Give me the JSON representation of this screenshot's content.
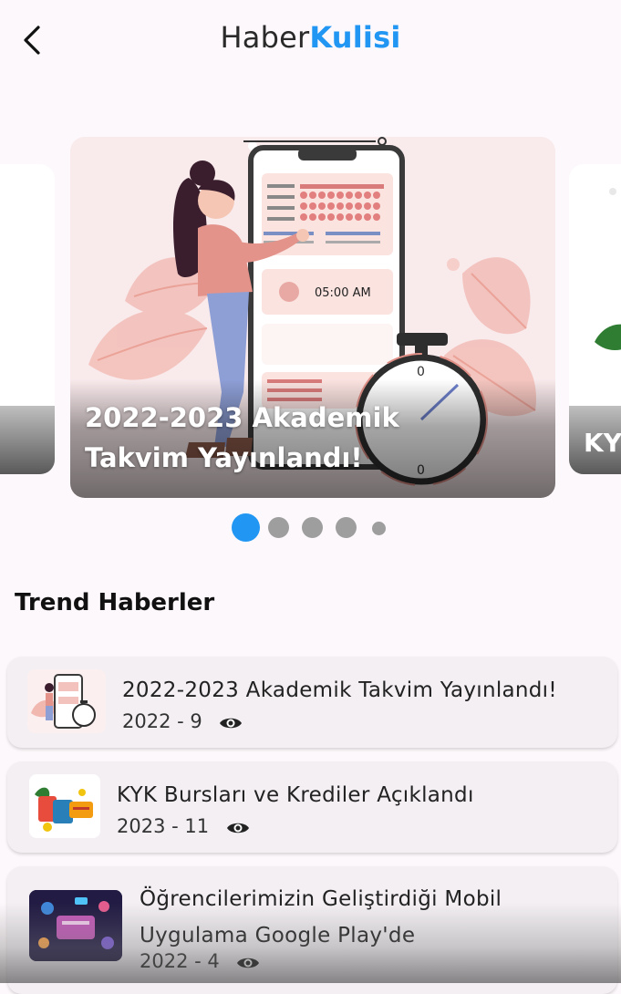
{
  "app": {
    "title_part1": "Haber",
    "title_part2": "Kulisi",
    "brand_color": "#2196f3"
  },
  "carousel": {
    "active_index": 0,
    "current": {
      "title": "2022-2023 Akademik Takvim Yayınlandı!",
      "illustration_clock_text": "05:00 AM"
    },
    "next_title_partial": "KY",
    "page_count": 5
  },
  "section": {
    "trending_title": "Trend Haberler"
  },
  "news": [
    {
      "title": "2022-2023 Akademik Takvim Yayınlandı!",
      "year": "2022",
      "views": "9"
    },
    {
      "title": "KYK Bursları ve Krediler Açıklandı",
      "year": "2023",
      "views": "11"
    },
    {
      "title": "Öğrencilerimizin Geliştirdiği Mobil Uygulama Google Play'de",
      "year": "2022",
      "views": "4"
    }
  ],
  "icons": {
    "back": "back-arrow-icon",
    "views": "eye-icon"
  }
}
